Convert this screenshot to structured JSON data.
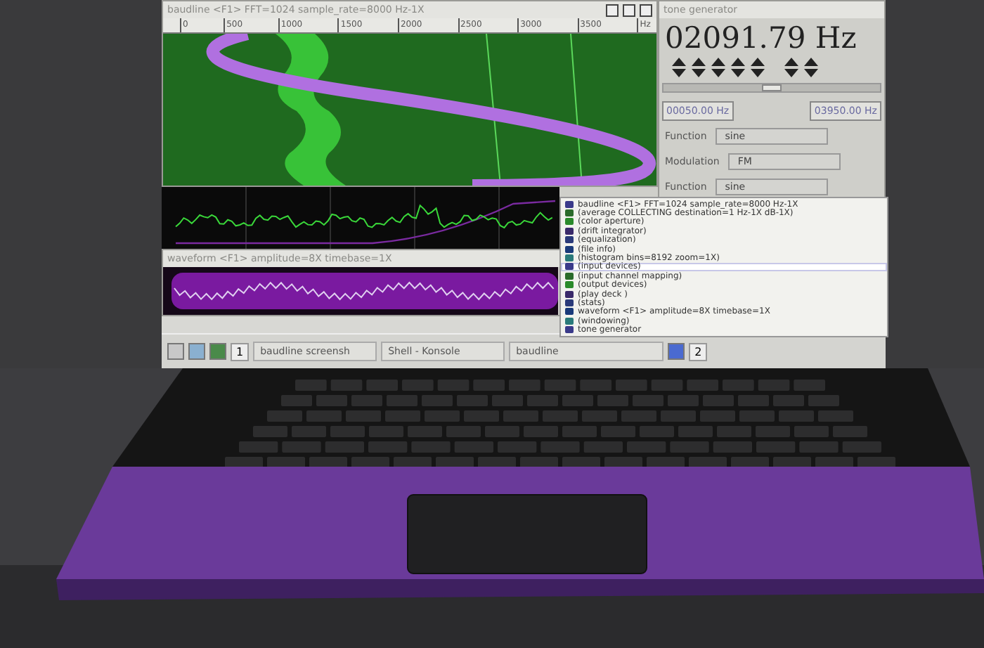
{
  "spectrogram_window": {
    "title": "baudline  <F1> FFT=1024 sample_rate=8000 Hz-1X",
    "ruler_ticks": [
      "0",
      "500",
      "1000",
      "1500",
      "2000",
      "2500",
      "3000",
      "3500",
      "Hz"
    ]
  },
  "waveform_window": {
    "title": "waveform  <F1> amplitude=8X timebase=1X"
  },
  "tone_generator": {
    "title": "tone generator",
    "frequency": "02091.79 Hz",
    "slider": {
      "level": 0.5
    },
    "low_frequency": "00050.00 Hz",
    "high_frequency": "03950.00 Hz",
    "controls": [
      {
        "label": "Function",
        "value": "sine"
      },
      {
        "label": "Modulation",
        "value": "FM"
      },
      {
        "label": "Function",
        "value": "sine"
      }
    ]
  },
  "menu": {
    "items": [
      {
        "label": "baudline  <F1> FFT=1024 sample_rate=8000 Hz-1X",
        "selected": false
      },
      {
        "label": "(average COLLECTING destination=1 Hz-1X dB-1X)",
        "selected": false
      },
      {
        "label": "(color aperture)",
        "selected": false
      },
      {
        "label": "(drift integrator)",
        "selected": false
      },
      {
        "label": "(equalization)",
        "selected": false
      },
      {
        "label": "(file info)",
        "selected": false
      },
      {
        "label": "(histogram  bins=8192 zoom=1X)",
        "selected": false
      },
      {
        "label": "(input devices)",
        "selected": true
      },
      {
        "label": "(input channel mapping)",
        "selected": false
      },
      {
        "label": "(output devices)",
        "selected": false
      },
      {
        "label": "(play deck  )",
        "selected": false
      },
      {
        "label": "(stats)",
        "selected": false
      },
      {
        "label": "waveform  <F1> amplitude=8X timebase=1X",
        "selected": false
      },
      {
        "label": "(windowing)",
        "selected": false
      },
      {
        "label": "tone generator",
        "selected": false
      }
    ]
  },
  "taskbar": {
    "tasks": [
      {
        "label": "baudline screensh"
      },
      {
        "label": "Shell - Konsole"
      },
      {
        "label": "baudline"
      }
    ],
    "pager": [
      "1",
      "2"
    ]
  }
}
